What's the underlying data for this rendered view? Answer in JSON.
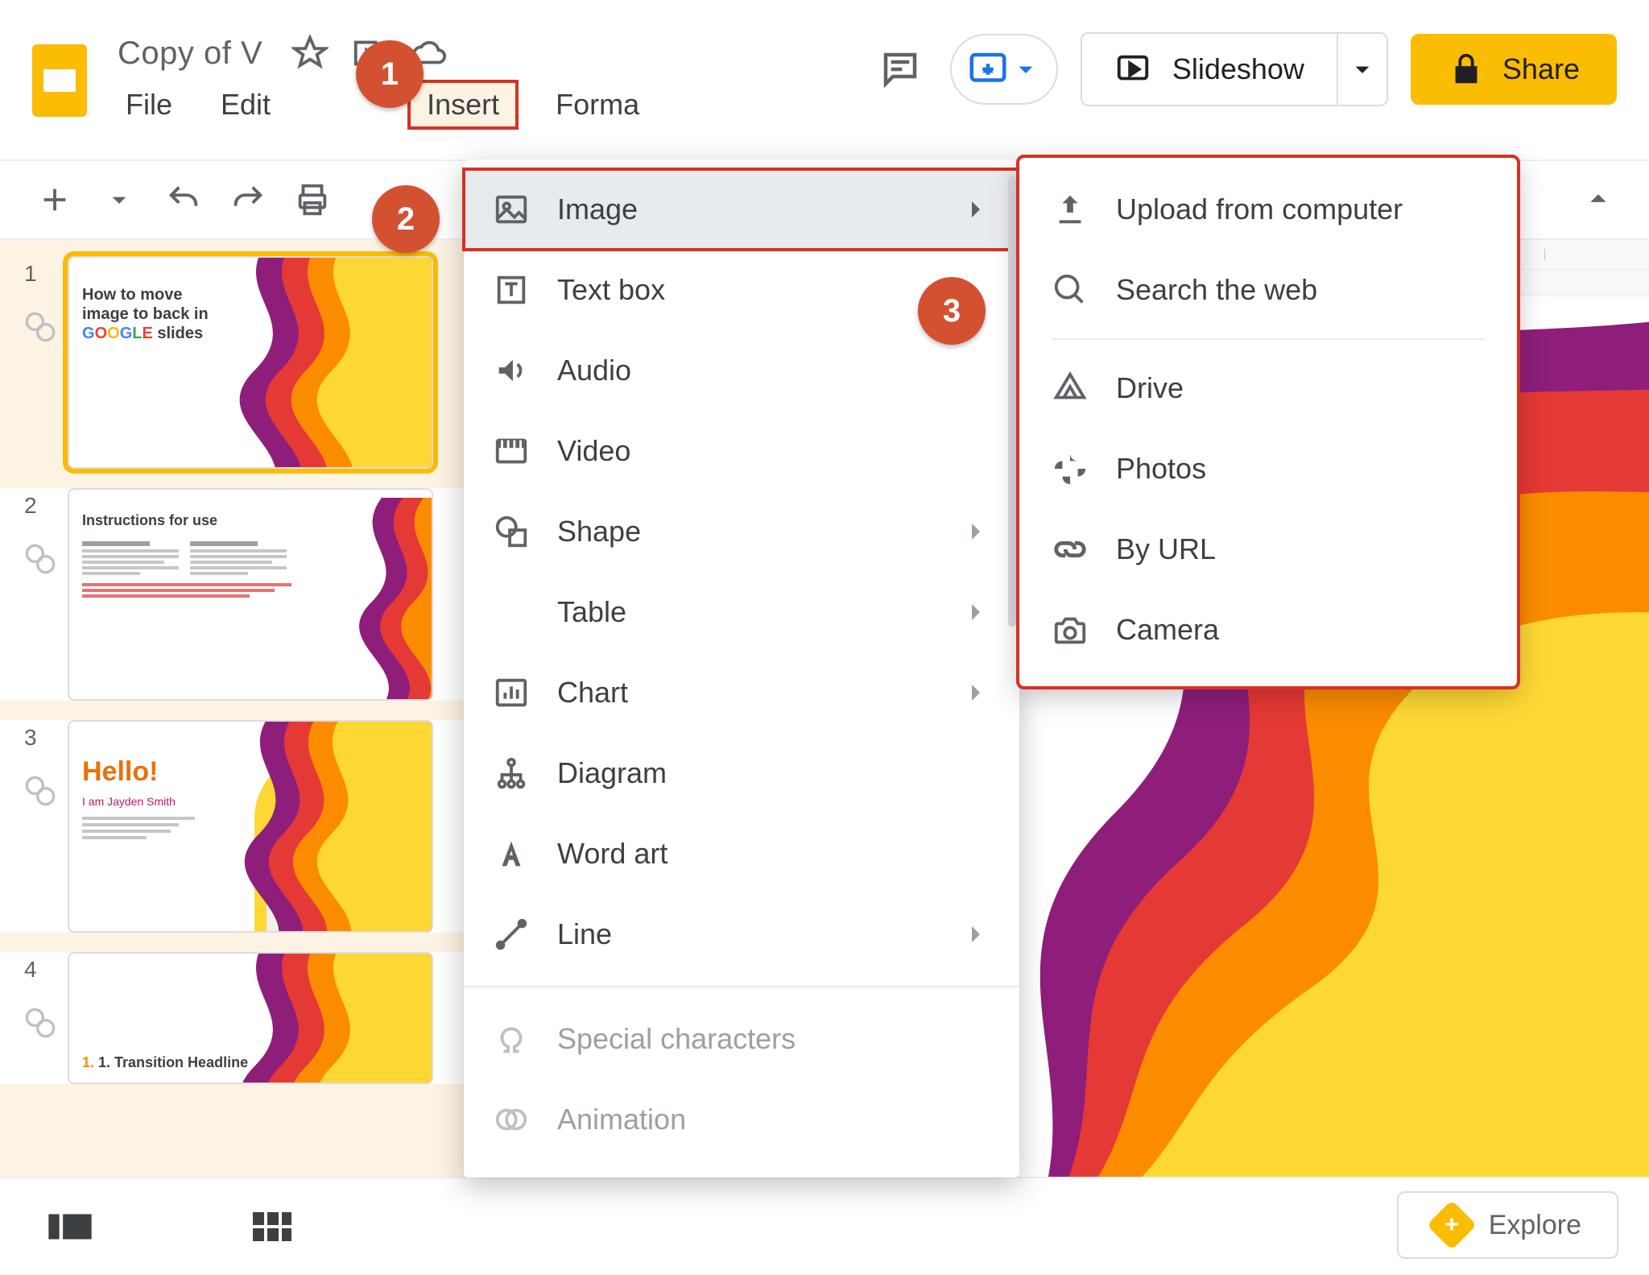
{
  "doc": {
    "title": "Copy of V"
  },
  "menubar": {
    "file": "File",
    "edit": "Edit",
    "insert": "Insert",
    "format": "Forma"
  },
  "actions": {
    "slideshow": "Slideshow",
    "share": "Share",
    "explore": "Explore"
  },
  "insert_menu": {
    "image": "Image",
    "textbox": "Text box",
    "audio": "Audio",
    "video": "Video",
    "shape": "Shape",
    "table": "Table",
    "chart": "Chart",
    "diagram": "Diagram",
    "wordart": "Word art",
    "line": "Line",
    "special": "Special characters",
    "animation": "Animation"
  },
  "image_submenu": {
    "upload": "Upload from computer",
    "search": "Search the web",
    "drive": "Drive",
    "photos": "Photos",
    "byurl": "By URL",
    "camera": "Camera"
  },
  "steps": {
    "one": "1",
    "two": "2",
    "three": "3"
  },
  "thumbs": {
    "n1": "1",
    "n2": "2",
    "n3": "3",
    "n4": "4",
    "slide1": {
      "line1": "How to move",
      "line2": "image to back in",
      "google": "GOOGLE",
      "line3_tail": " slides"
    },
    "slide2": {
      "heading": "Instructions for use"
    },
    "slide3": {
      "hello": "Hello!",
      "sub": "I am Jayden Smith"
    },
    "slide4": {
      "head": "1. Transition Headline"
    }
  }
}
